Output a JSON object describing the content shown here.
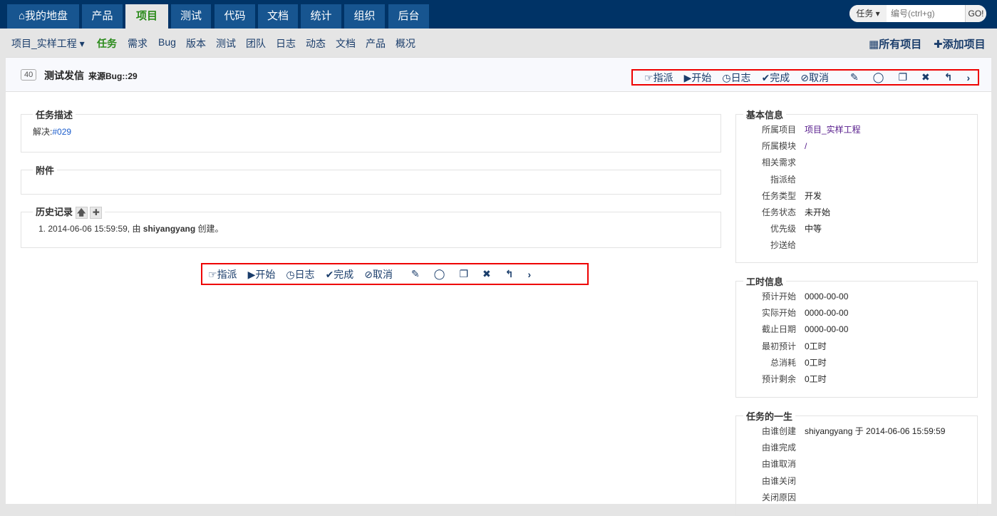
{
  "topnav": {
    "tabs": [
      {
        "label": "我的地盘",
        "icon": "home-icon"
      },
      {
        "label": "产品"
      },
      {
        "label": "项目"
      },
      {
        "label": "测试"
      },
      {
        "label": "代码"
      },
      {
        "label": "文档"
      },
      {
        "label": "统计"
      },
      {
        "label": "组织"
      },
      {
        "label": "后台"
      }
    ],
    "search": {
      "type": "任务",
      "placeholder": "编号(ctrl+g)",
      "go": "GO!"
    }
  },
  "subnav": {
    "project": "项目_实样工程",
    "items": [
      "任务",
      "需求",
      "Bug",
      "版本",
      "测试",
      "团队",
      "日志",
      "动态",
      "文档",
      "产品",
      "概况"
    ],
    "all_projects": "所有项目",
    "add_project": "添加项目"
  },
  "task": {
    "id": "40",
    "title": "测试发信",
    "source": "来源Bug::29"
  },
  "actions": {
    "assign": "指派",
    "start": "开始",
    "log": "日志",
    "finish": "完成",
    "cancel": "取消"
  },
  "description": {
    "legend": "任务描述",
    "prefix": "解决:",
    "link": "#029"
  },
  "attachments": {
    "legend": "附件"
  },
  "history": {
    "legend": "历史记录",
    "items": [
      {
        "num": "1.",
        "time": "2014-06-06 15:59:59, 由 ",
        "user": "shiyangyang",
        "action": " 创建。"
      }
    ]
  },
  "basic": {
    "legend": "基本信息",
    "rows": [
      {
        "k": "所属项目",
        "v": "项目_实样工程"
      },
      {
        "k": "所属模块",
        "v": "/"
      },
      {
        "k": "相关需求",
        "v": ""
      },
      {
        "k": "指派给",
        "v": ""
      },
      {
        "k": "任务类型",
        "v": "开发"
      },
      {
        "k": "任务状态",
        "v": "未开始"
      },
      {
        "k": "优先级",
        "v": "中等"
      },
      {
        "k": "抄送给",
        "v": ""
      }
    ]
  },
  "effort": {
    "legend": "工时信息",
    "rows": [
      {
        "k": "预计开始",
        "v": "0000-00-00"
      },
      {
        "k": "实际开始",
        "v": "0000-00-00"
      },
      {
        "k": "截止日期",
        "v": "0000-00-00"
      },
      {
        "k": "最初预计",
        "v": "0工时"
      },
      {
        "k": "总消耗",
        "v": "0工时"
      },
      {
        "k": "预计剩余",
        "v": "0工时"
      }
    ]
  },
  "life": {
    "legend": "任务的一生",
    "rows": [
      {
        "k": "由谁创建",
        "v": "shiyangyang 于 2014-06-06 15:59:59"
      },
      {
        "k": "由谁完成",
        "v": ""
      },
      {
        "k": "由谁取消",
        "v": ""
      },
      {
        "k": "由谁关闭",
        "v": ""
      },
      {
        "k": "关闭原因",
        "v": ""
      }
    ]
  }
}
